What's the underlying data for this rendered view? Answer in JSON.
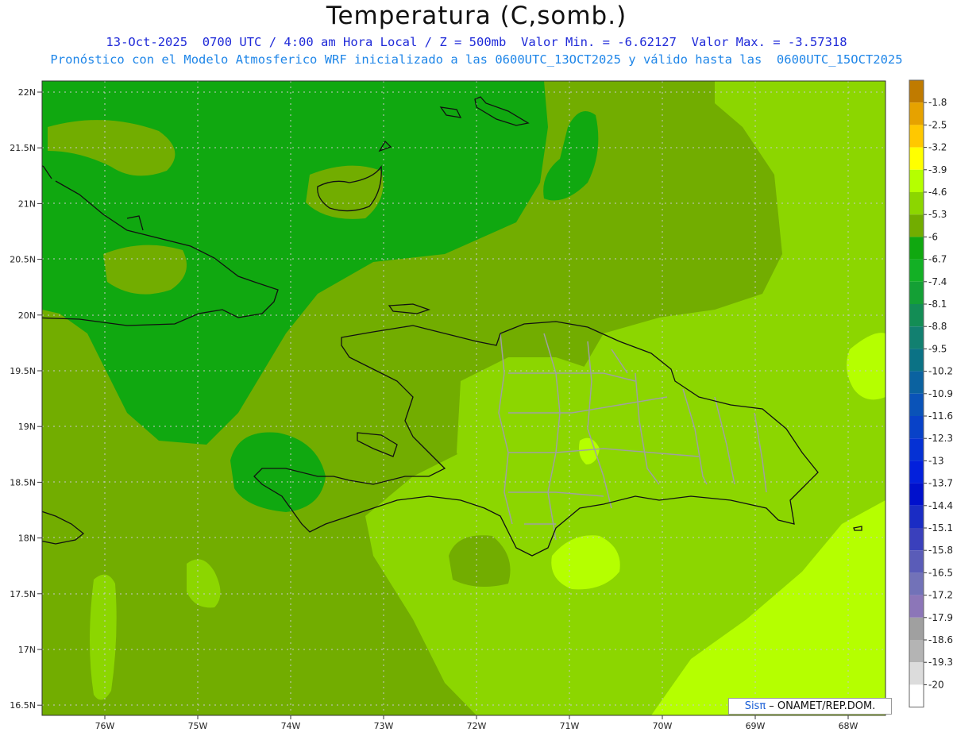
{
  "title": "Temperatura (C,somb.)",
  "subtitle_line1": "13-Oct-2025  0700 UTC / 4:00 am Hora Local / Z = 500mb  Valor Min. = -6.62127  Valor Max. = -3.57318",
  "subtitle_line2": "Pronóstico con el Modelo Atmosferico WRF inicializado a las 0600UTC_13OCT2025 y válido hasta las  0600UTC_15OCT2025",
  "credit": {
    "brand": "Sisπ",
    "text": " – ONAMET/REP.DOM."
  },
  "lat_labels": [
    "22N",
    "21.5N",
    "21N",
    "20.5N",
    "20N",
    "19.5N",
    "19N",
    "18.5N",
    "18N",
    "17.5N",
    "17N",
    "16.5N"
  ],
  "lon_labels": [
    "76W",
    "75W",
    "74W",
    "73W",
    "72W",
    "71W",
    "70W",
    "69W",
    "68W"
  ],
  "colorbar": [
    {
      "label": "-1.8",
      "color": "#c07b00"
    },
    {
      "label": "-2.5",
      "color": "#e6a200"
    },
    {
      "label": "-3.2",
      "color": "#ffc800"
    },
    {
      "label": "-3.9",
      "color": "#ffff00"
    },
    {
      "label": "-4.6",
      "color": "#b5ff00"
    },
    {
      "label": "-5.3",
      "color": "#8cd600"
    },
    {
      "label": "-6",
      "color": "#72ad00"
    },
    {
      "label": "-6.7",
      "color": "#10a810"
    },
    {
      "label": "-7.4",
      "color": "#13b025"
    },
    {
      "label": "-8.1",
      "color": "#14a035"
    },
    {
      "label": "-8.8",
      "color": "#138d55"
    },
    {
      "label": "-9.5",
      "color": "#128070"
    },
    {
      "label": "-10.2",
      "color": "#0b7285"
    },
    {
      "label": "-10.9",
      "color": "#0b62a0"
    },
    {
      "label": "-11.6",
      "color": "#0a53b8"
    },
    {
      "label": "-12.3",
      "color": "#0842c8"
    },
    {
      "label": "-13",
      "color": "#0531d4"
    },
    {
      "label": "-13.7",
      "color": "#0320dc"
    },
    {
      "label": "-14.4",
      "color": "#0010cc"
    },
    {
      "label": "-15.1",
      "color": "#1a2cc4"
    },
    {
      "label": "-15.8",
      "color": "#3a40bc"
    },
    {
      "label": "-16.5",
      "color": "#5a5cb8"
    },
    {
      "label": "-17.2",
      "color": "#7272b8"
    },
    {
      "label": "-17.9",
      "color": "#8c76b8"
    },
    {
      "label": "-18.6",
      "color": "#a0a0a0"
    },
    {
      "label": "-19.3",
      "color": "#b4b4b4"
    },
    {
      "label": "-20",
      "color": "#dcdcdc"
    }
  ],
  "field_colors": {
    "dark_green": "#10a810",
    "olive": "#72ad00",
    "light_green": "#8cd600",
    "yellow_green": "#b5ff00",
    "coast": "#111111",
    "borders": "#a0a0a0"
  }
}
